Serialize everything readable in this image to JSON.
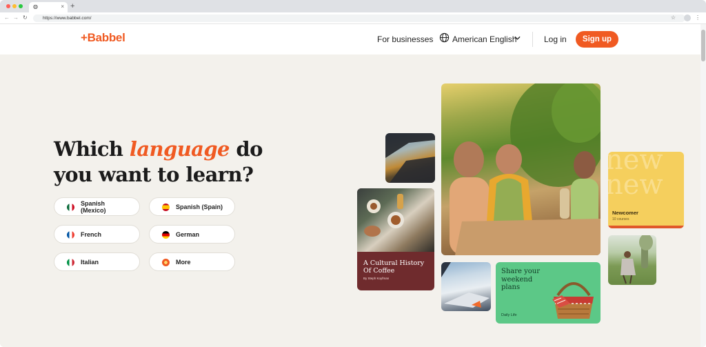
{
  "browser": {
    "tab_icon": "globe-icon",
    "url": "https://www.babbel.com/",
    "new_tab": "+",
    "close_tab": "×"
  },
  "header": {
    "logo": "+Babbel",
    "for_businesses": "For businesses",
    "language_selector": "American English",
    "login": "Log in",
    "signup": "Sign up"
  },
  "hero": {
    "title_before": "Which ",
    "title_accent": "language",
    "title_after": " do you want to learn?"
  },
  "languages": [
    {
      "label": "Spanish (Mexico)",
      "flag": "mexico-flag-icon"
    },
    {
      "label": "Spanish (Spain)",
      "flag": "spain-flag-icon"
    },
    {
      "label": "French",
      "flag": "france-flag-icon"
    },
    {
      "label": "German",
      "flag": "germany-flag-icon"
    },
    {
      "label": "Italian",
      "flag": "italy-flag-icon"
    },
    {
      "label": "More",
      "flag": "more-languages-icon"
    }
  ],
  "cards": {
    "coffee_title": "A Cultural History Of Coffee",
    "coffee_author": "By Steph Koyfman",
    "weekend_title": "Share your weekend plans",
    "weekend_tag": "Daily Life",
    "newcomer_title": "Newcomer",
    "newcomer_count": "10 courses",
    "newcomer_watermark": "new new"
  },
  "colors": {
    "brand": "#f05a22",
    "coffee_card": "#6f2b2d",
    "weekend_card": "#5cc887",
    "newcomer_card": "#f5cf5d"
  }
}
